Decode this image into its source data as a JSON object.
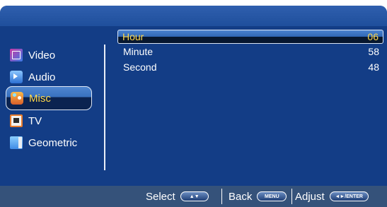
{
  "sidebar": {
    "items": [
      {
        "label": "Video",
        "icon": "video-icon"
      },
      {
        "label": "Audio",
        "icon": "audio-icon"
      },
      {
        "label": "Misc",
        "icon": "misc-icon",
        "selected": true
      },
      {
        "label": "TV",
        "icon": "tv-icon"
      },
      {
        "label": "Geometric",
        "icon": "geometric-icon"
      }
    ]
  },
  "settings": {
    "rows": [
      {
        "label": "Hour",
        "value": "06",
        "selected": true
      },
      {
        "label": "Minute",
        "value": "58"
      },
      {
        "label": "Second",
        "value": "48"
      }
    ]
  },
  "footer": {
    "select_label": "Select",
    "select_key": "▲▼",
    "back_label": "Back",
    "back_key": "MENU",
    "adjust_label": "Adjust",
    "adjust_key": "◄►/ENTER"
  },
  "colors": {
    "panel": "#15418f",
    "highlight_text": "#ffd84a",
    "text": "#ffffff",
    "footer": "#35527a"
  }
}
